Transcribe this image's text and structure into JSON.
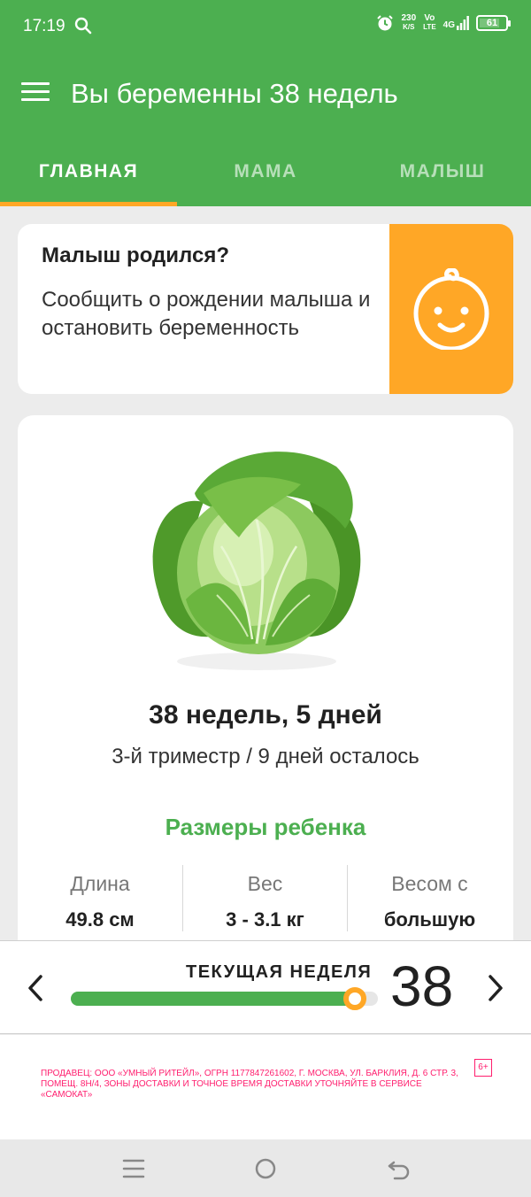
{
  "status_bar": {
    "time": "17:19",
    "net_speed_value": "230",
    "net_speed_unit": "K/S",
    "volte_top": "Vo",
    "volte_bottom": "LTE",
    "signal_label": "4G",
    "battery": "61",
    "icons": [
      "search-icon",
      "alarm-icon",
      "signal-icon",
      "battery-icon"
    ]
  },
  "header": {
    "title": "Вы беременны 38 недель",
    "menu_icon": "hamburger-icon"
  },
  "tabs": [
    {
      "label": "ГЛАВНАЯ",
      "active": true
    },
    {
      "label": "МАМА",
      "active": false
    },
    {
      "label": "МАЛЫШ",
      "active": false
    }
  ],
  "born_card": {
    "title": "Малыш родился?",
    "text": "Сообщить о рождении малыша и остановить беременность",
    "icon": "baby-face-icon"
  },
  "week_card": {
    "image": "cabbage",
    "title": "38 недель, 5 дней",
    "subtitle": "3-й триместр / 9 дней осталось",
    "sizes_title": "Размеры ребенка",
    "sizes": [
      {
        "label": "Длина",
        "value": "49.8 см"
      },
      {
        "label": "Вес",
        "value": "3 - 3.1 кг"
      },
      {
        "label": "Весом с",
        "value": "большую"
      }
    ]
  },
  "week_bar": {
    "label": "ТЕКУЩАЯ НЕДЕЛЯ",
    "week": "38",
    "progress": 0.925
  },
  "ad": {
    "text": "ПРОДАВЕЦ: ООО «УМНЫЙ РИТЕЙЛ», ОГРН 1177847261602, Г. МОСКВА, УЛ. БАРКЛИЯ, Д. 6 СТР. 3, ПОМЕЩ. 8Н/4, ЗОНЫ ДОСТАВКИ И ТОЧНОЕ ВРЕМЯ ДОСТАВКИ УТОЧНЯЙТЕ В СЕРВИСЕ «САМОКАТ»",
    "age": "6+"
  },
  "colors": {
    "primary": "#4caf50",
    "accent": "#ffa726",
    "background": "#ececec",
    "ad_text": "#ff1e6e"
  }
}
